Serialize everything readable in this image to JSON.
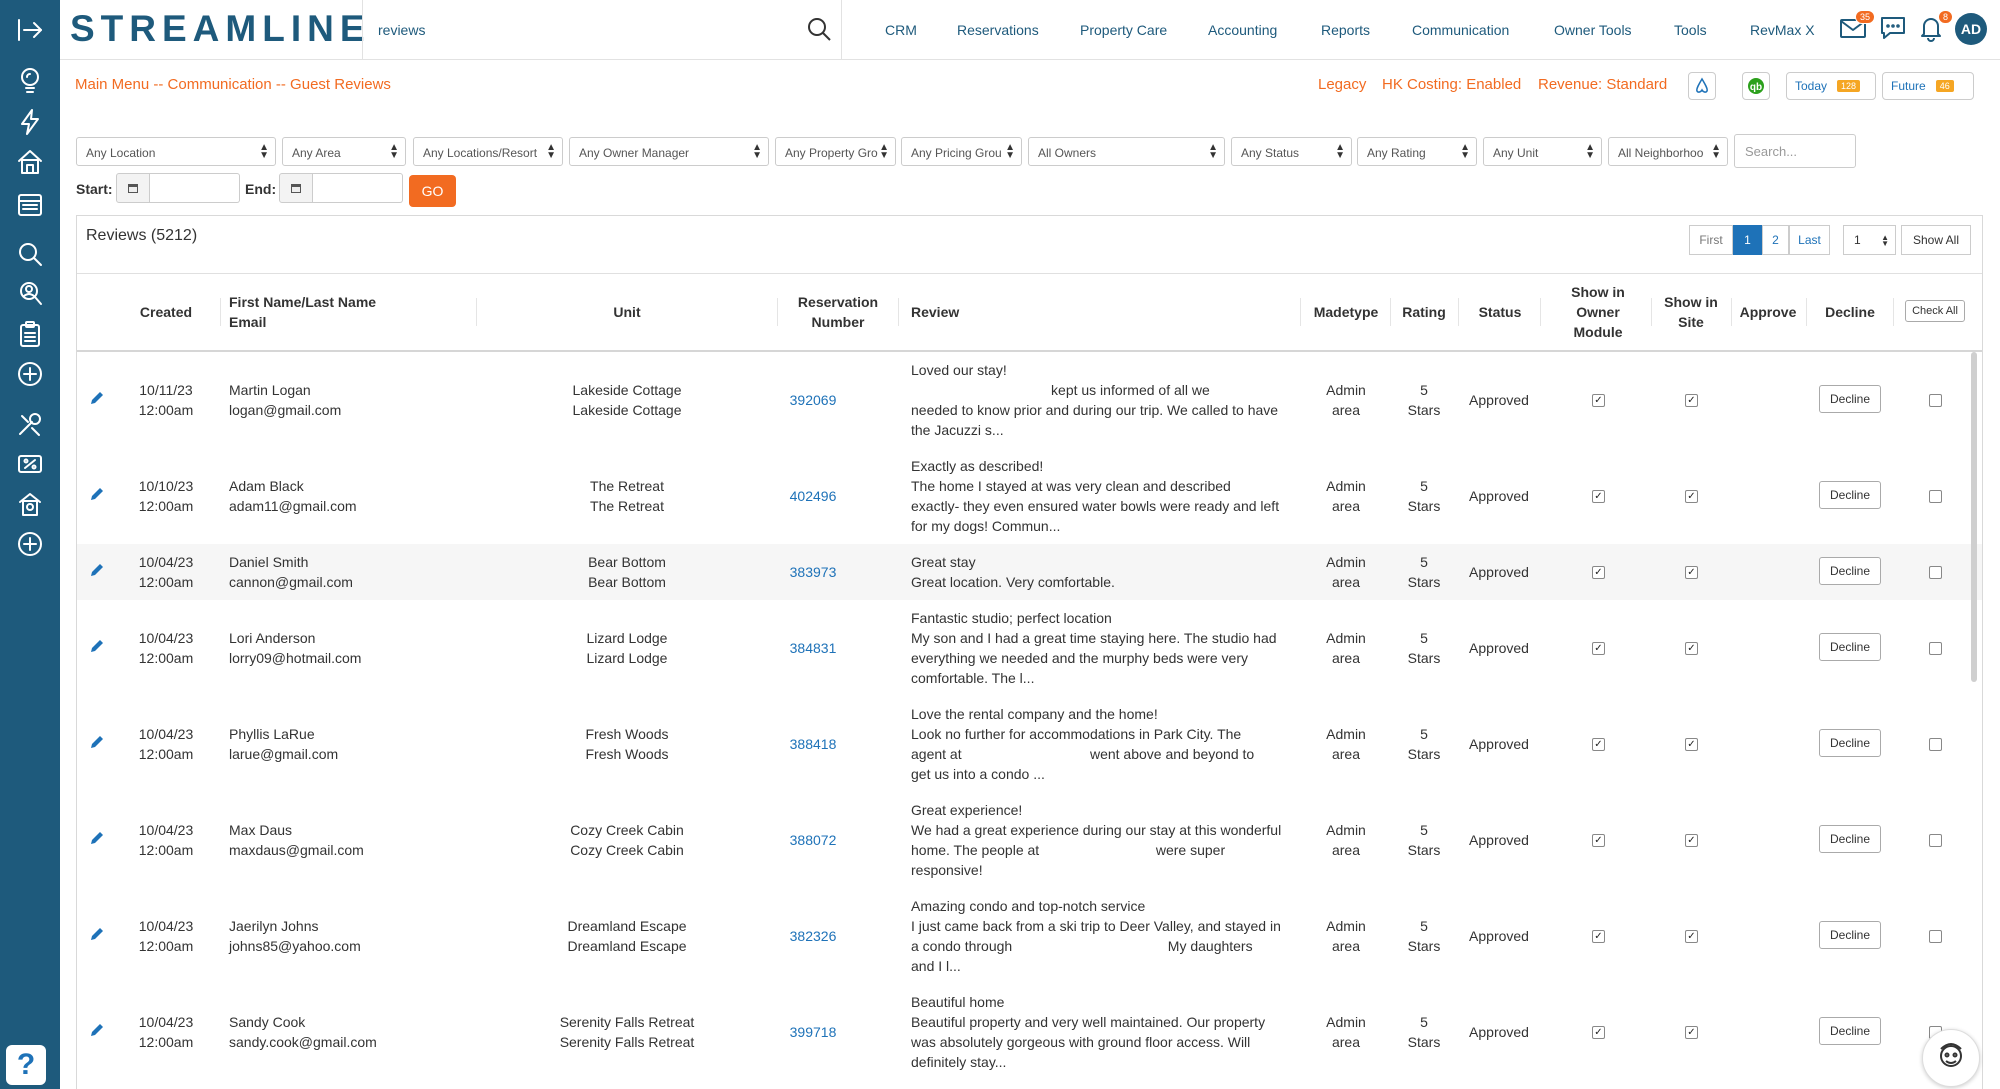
{
  "app": {
    "logo": "STREAMLINE",
    "page_tag": "reviews"
  },
  "nav": [
    "CRM",
    "Reservations",
    "Property Care",
    "Accounting",
    "Reports",
    "Communication",
    "Owner Tools",
    "Tools",
    "RevMax X"
  ],
  "header_badges": {
    "mail": "35",
    "alerts": "8"
  },
  "user": {
    "initials": "AD"
  },
  "breadcrumb": "Main Menu -- Communication -- Guest Reviews",
  "status_links": {
    "legacy": "Legacy",
    "hk_costing": "HK Costing: Enabled",
    "revenue": "Revenue: Standard"
  },
  "today": {
    "label": "Today",
    "count": "128"
  },
  "future": {
    "label": "Future",
    "count": "46"
  },
  "filters": [
    "Any Location",
    "Any Area",
    "Any Locations/Resort",
    "Any Owner Manager",
    "Any Property Gro",
    "Any Pricing Grou",
    "All Owners",
    "Any Status",
    "Any Rating",
    "Any Unit",
    "All Neighborhoo"
  ],
  "search_placeholder": "Search...",
  "date_filter": {
    "start_label": "Start:",
    "end_label": "End:",
    "go_label": "GO"
  },
  "panel_title": "Reviews (5212)",
  "pagination": {
    "first": "First",
    "pages": [
      "1",
      "2"
    ],
    "last": "Last",
    "per_page": "1",
    "show_all": "Show All"
  },
  "columns": {
    "created": "Created",
    "name_line1": "First Name/Last Name",
    "name_line2": "Email",
    "unit": "Unit",
    "res_line1": "Reservation",
    "res_line2": "Number",
    "review": "Review",
    "madetype": "Madetype",
    "rating": "Rating",
    "status": "Status",
    "owner_line1": "Show in",
    "owner_line2": "Owner",
    "owner_line3": "Module",
    "site_line1": "Show in",
    "site_line2": "Site",
    "approve": "Approve",
    "decline": "Decline",
    "check_all": "Check All"
  },
  "rows": [
    {
      "date": "10/11/23",
      "time": "12:00am",
      "name": "Martin Logan",
      "email": "logan@gmail.com",
      "unit": "Lakeside Cottage",
      "unit2": "Lakeside Cottage",
      "res": "392069",
      "review": [
        "Loved our stay!",
        "                                    kept us informed of all we",
        "needed to know prior and during our trip. We called to have",
        "the Jacuzzi s..."
      ],
      "made1": "Admin",
      "made2": "area",
      "rating1": "5",
      "rating2": "Stars",
      "status": "Approved",
      "decline": "Decline"
    },
    {
      "date": "10/10/23",
      "time": "12:00am",
      "name": "Adam Black",
      "email": "adam11@gmail.com",
      "unit": "The Retreat",
      "unit2": "The Retreat",
      "res": "402496",
      "review": [
        "Exactly as described!",
        "The home I stayed at was very clean and described",
        "exactly- they even ensured water bowls were ready and left",
        "for my dogs! Commun..."
      ],
      "made1": "Admin",
      "made2": "area",
      "rating1": "5",
      "rating2": "Stars",
      "status": "Approved",
      "decline": "Decline"
    },
    {
      "date": "10/04/23",
      "time": "12:00am",
      "name": "Daniel Smith",
      "email": "cannon@gmail.com",
      "unit": "Bear Bottom",
      "unit2": "Bear Bottom",
      "res": "383973",
      "review": [
        "Great stay",
        "Great location. Very comfortable."
      ],
      "made1": "Admin",
      "made2": "area",
      "rating1": "5",
      "rating2": "Stars",
      "status": "Approved",
      "decline": "Decline"
    },
    {
      "date": "10/04/23",
      "time": "12:00am",
      "name": "Lori Anderson",
      "email": "lorry09@hotmail.com",
      "unit": "Lizard Lodge",
      "unit2": "Lizard Lodge",
      "res": "384831",
      "review": [
        "Fantastic studio; perfect location",
        "My son and I had a great time staying here. The studio had",
        "everything we needed and the murphy beds were very",
        "comfortable. The l..."
      ],
      "made1": "Admin",
      "made2": "area",
      "rating1": "5",
      "rating2": "Stars",
      "status": "Approved",
      "decline": "Decline"
    },
    {
      "date": "10/04/23",
      "time": "12:00am",
      "name": "Phyllis LaRue",
      "email": "larue@gmail.com",
      "unit": "Fresh Woods",
      "unit2": "Fresh Woods",
      "res": "388418",
      "review": [
        "Love the rental company and the home!",
        "Look no further for accommodations in Park City. The",
        "agent at                                 went above and beyond to",
        "get us into a condo ..."
      ],
      "made1": "Admin",
      "made2": "area",
      "rating1": "5",
      "rating2": "Stars",
      "status": "Approved",
      "decline": "Decline"
    },
    {
      "date": "10/04/23",
      "time": "12:00am",
      "name": "Max Daus",
      "email": "maxdaus@gmail.com",
      "unit": "Cozy Creek Cabin",
      "unit2": "Cozy Creek Cabin",
      "res": "388072",
      "review": [
        "Great experience!",
        "We had a great experience during our stay at this wonderful",
        "home. The people at                              were super",
        "responsive!"
      ],
      "made1": "Admin",
      "made2": "area",
      "rating1": "5",
      "rating2": "Stars",
      "status": "Approved",
      "decline": "Decline"
    },
    {
      "date": "10/04/23",
      "time": "12:00am",
      "name": "Jaerilyn Johns",
      "email": "johns85@yahoo.com",
      "unit": "Dreamland Escape",
      "unit2": "Dreamland Escape",
      "res": "382326",
      "review": [
        "Amazing condo and top-notch service",
        "I just came back from a ski trip to Deer Valley, and stayed in",
        "a condo through                                        My daughters",
        "and I l..."
      ],
      "made1": "Admin",
      "made2": "area",
      "rating1": "5",
      "rating2": "Stars",
      "status": "Approved",
      "decline": "Decline"
    },
    {
      "date": "10/04/23",
      "time": "12:00am",
      "name": "Sandy Cook",
      "email": "sandy.cook@gmail.com",
      "unit": "Serenity Falls Retreat",
      "unit2": "Serenity Falls Retreat",
      "res": "399718",
      "review": [
        "Beautiful home",
        "Beautiful property and very well maintained. Our property",
        "was absolutely gorgeous with ground floor access. Will",
        "definitely stay..."
      ],
      "made1": "Admin",
      "made2": "area",
      "rating1": "5",
      "rating2": "Stars",
      "status": "Approved",
      "decline": "Decline"
    }
  ],
  "help_label": "?",
  "colors": {
    "sidebar": "#1e5a7c",
    "accent": "#f26b21",
    "link": "#1e72b8"
  }
}
